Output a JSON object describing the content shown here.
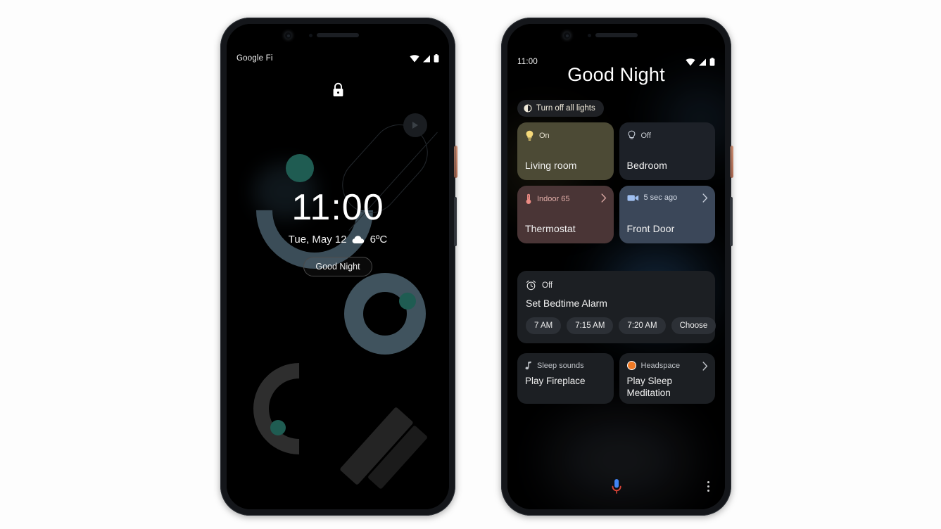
{
  "page": {
    "background_color": "#fdfdfd"
  },
  "left_phone": {
    "name": "lock-screen-phone",
    "status_bar": {
      "carrier": "Google Fi",
      "icons": [
        "wifi-icon",
        "signal-icon",
        "battery-icon"
      ]
    },
    "lock_icon": "lock-icon",
    "clock": {
      "time": "11:00",
      "date": "Tue, May 12",
      "weather_icon": "cloud-icon",
      "temperature": "6ºC"
    },
    "action_pill": {
      "label": "Good Night"
    },
    "wallpaper": {
      "accent_slate": "#3b4d58",
      "accent_teal": "#1f5c52",
      "accent_dark_gray": "#2e2e2e",
      "shapes": [
        "c-arc",
        "rounded-rect-outline",
        "ring",
        "hook",
        "diagonal-bar",
        "small-circle"
      ]
    }
  },
  "right_phone": {
    "name": "good-night-routine-phone",
    "status_bar": {
      "time": "11:00",
      "icons": [
        "wifi-icon",
        "signal-icon",
        "battery-icon"
      ]
    },
    "title": "Good Night",
    "lights_chip": {
      "label": "Turn off all lights",
      "icon": "brightness-power-icon"
    },
    "device_cards": [
      {
        "status": "On",
        "name": "Living room",
        "icon": "lightbulb-filled-icon",
        "bg": "#4c4a35",
        "icon_color": "#f5d97a",
        "status_color": "#f3eddc",
        "has_chevron": false
      },
      {
        "status": "Off",
        "name": "Bedroom",
        "icon": "lightbulb-outline-icon",
        "bg": "#1d2128",
        "icon_color": "#c9d0da",
        "status_color": "#d8dce2",
        "has_chevron": false
      },
      {
        "status": "Indoor 65",
        "name": "Thermostat",
        "icon": "thermostat-icon",
        "bg": "#4a3536",
        "icon_color": "#ec8b84",
        "status_color": "#efb9b3",
        "has_chevron": true
      },
      {
        "status": "5 sec ago",
        "name": "Front Door",
        "icon": "video-camera-icon",
        "bg": "#3b4759",
        "icon_color": "#9fbff0",
        "status_color": "#dde4ef",
        "has_chevron": true
      }
    ],
    "alarm_card": {
      "icon": "alarm-clock-icon",
      "status": "Off",
      "title": "Set Bedtime Alarm",
      "chips": [
        "7 AM",
        "7:15 AM",
        "7:20 AM",
        "Choose"
      ]
    },
    "media_cards": [
      {
        "source": "Sleep sounds",
        "icon": "music-note-icon",
        "title": "Play Fireplace",
        "has_chevron": false
      },
      {
        "source": "Headspace",
        "icon": "headspace-circle-icon",
        "icon_color": "#f07a25",
        "title": "Play Sleep Meditation",
        "has_chevron": true
      }
    ],
    "bottom_bar": {
      "mic": "assistant-mic-icon",
      "overflow": "overflow-menu-icon"
    }
  }
}
